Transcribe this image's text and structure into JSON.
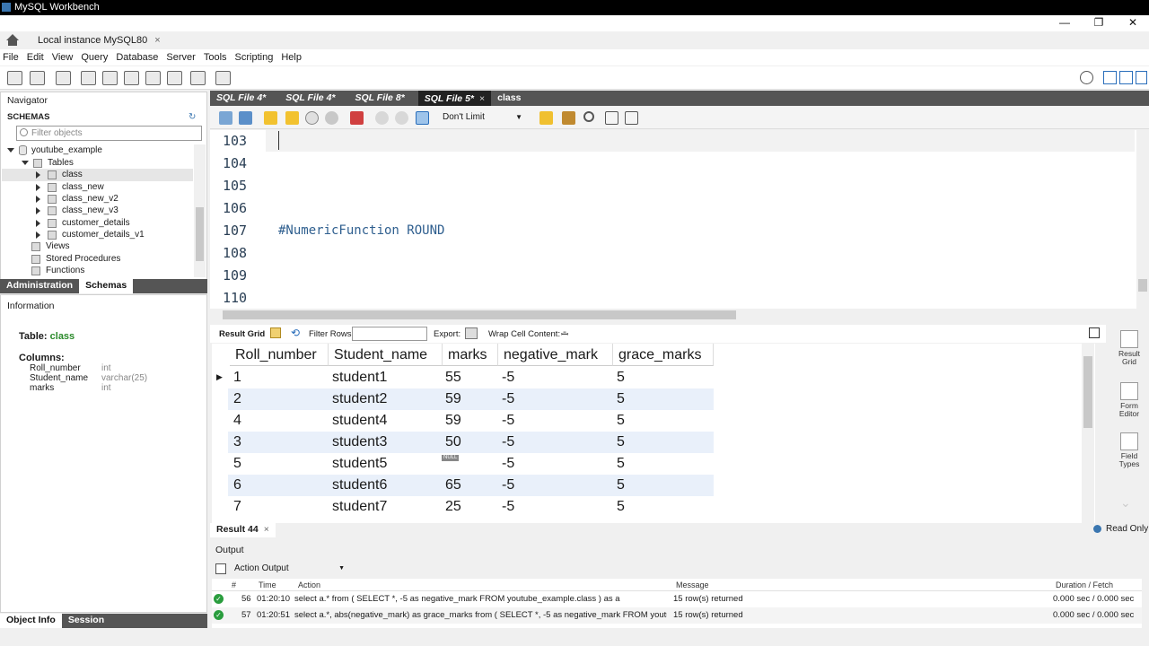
{
  "window": {
    "title": "MySQL Workbench",
    "connection_tab": "Local instance MySQL80",
    "close_glyph": "×",
    "minimize_glyph": "—",
    "restore_glyph": "❐",
    "close_window_glyph": "✕"
  },
  "menu": [
    "File",
    "Edit",
    "View",
    "Query",
    "Database",
    "Server",
    "Tools",
    "Scripting",
    "Help"
  ],
  "navigator": {
    "title": "Navigator",
    "schemas_label": "SCHEMAS",
    "filter_placeholder": "Filter objects",
    "schema": "youtube_example",
    "tables_label": "Tables",
    "tables": [
      "class",
      "class_new",
      "class_new_v2",
      "class_new_v3",
      "customer_details",
      "customer_details_v1"
    ],
    "views_label": "Views",
    "stored_procedures_label": "Stored Procedures",
    "functions_label": "Functions",
    "tabs": [
      "Administration",
      "Schemas"
    ],
    "active_tab": "Schemas"
  },
  "info_panel": {
    "title": "Information",
    "table_label": "Table:",
    "table_name": "class",
    "columns_label": "Columns:",
    "columns": [
      {
        "name": "Roll_number",
        "type": "int"
      },
      {
        "name": "Student_name",
        "type": "varchar(25)"
      },
      {
        "name": "marks",
        "type": "int"
      }
    ],
    "bottom_tabs": [
      "Object Info",
      "Session"
    ]
  },
  "editor_tabs": [
    "SQL File 4*",
    "SQL File 4*",
    "SQL File 8*",
    "SQL File 5*",
    "class"
  ],
  "active_editor_tab": "SQL File 5*",
  "sql_toolbar": {
    "limit_value": "Don't Limit"
  },
  "editor": {
    "lines": [
      {
        "num": "103",
        "text": ""
      },
      {
        "num": "104",
        "text": ""
      },
      {
        "num": "105",
        "text": ""
      },
      {
        "num": "106",
        "text": ""
      },
      {
        "num": "107",
        "text": "#NumericFunction ROUND"
      },
      {
        "num": "108",
        "text": ""
      },
      {
        "num": "109",
        "text": ""
      },
      {
        "num": "110",
        "text": ""
      }
    ]
  },
  "result_toolbar": {
    "result_grid": "Result Grid",
    "filter_rows": "Filter Rows:",
    "export": "Export:",
    "wrap_cell": "Wrap Cell Content:"
  },
  "result_grid": {
    "columns": [
      "Roll_number",
      "Student_name",
      "marks",
      "negative_mark",
      "grace_marks"
    ],
    "rows": [
      [
        "1",
        "student1",
        "55",
        "-5",
        "5"
      ],
      [
        "2",
        "student2",
        "59",
        "-5",
        "5"
      ],
      [
        "4",
        "student4",
        "59",
        "-5",
        "5"
      ],
      [
        "3",
        "student3",
        "50",
        "-5",
        "5"
      ],
      [
        "5",
        "student5",
        "NULL",
        "-5",
        "5"
      ],
      [
        "6",
        "student6",
        "65",
        "-5",
        "5"
      ],
      [
        "7",
        "student7",
        "25",
        "-5",
        "5"
      ]
    ]
  },
  "side_panel": [
    "Result Grid",
    "Form Editor",
    "Field Types"
  ],
  "result_tab": "Result 44",
  "read_only": "Read Only",
  "output": {
    "title": "Output",
    "mode": "Action Output",
    "headers": {
      "num": "#",
      "time": "Time",
      "action": "Action",
      "message": "Message",
      "duration": "Duration / Fetch"
    },
    "rows": [
      {
        "num": "56",
        "time": "01:20:10",
        "action": "select a.* from ( SELECT *, -5 as negative_mark  FROM youtube_example.class ) as a",
        "message": "15 row(s) returned",
        "duration": "0.000 sec / 0.000 sec"
      },
      {
        "num": "57",
        "time": "01:20:51",
        "action": "select a.*, abs(negative_mark) as grace_marks  from ( SELECT *, -5 as negative_mark  FROM youtube...",
        "message": "15 row(s) returned",
        "duration": "0.000 sec / 0.000 sec"
      }
    ]
  }
}
